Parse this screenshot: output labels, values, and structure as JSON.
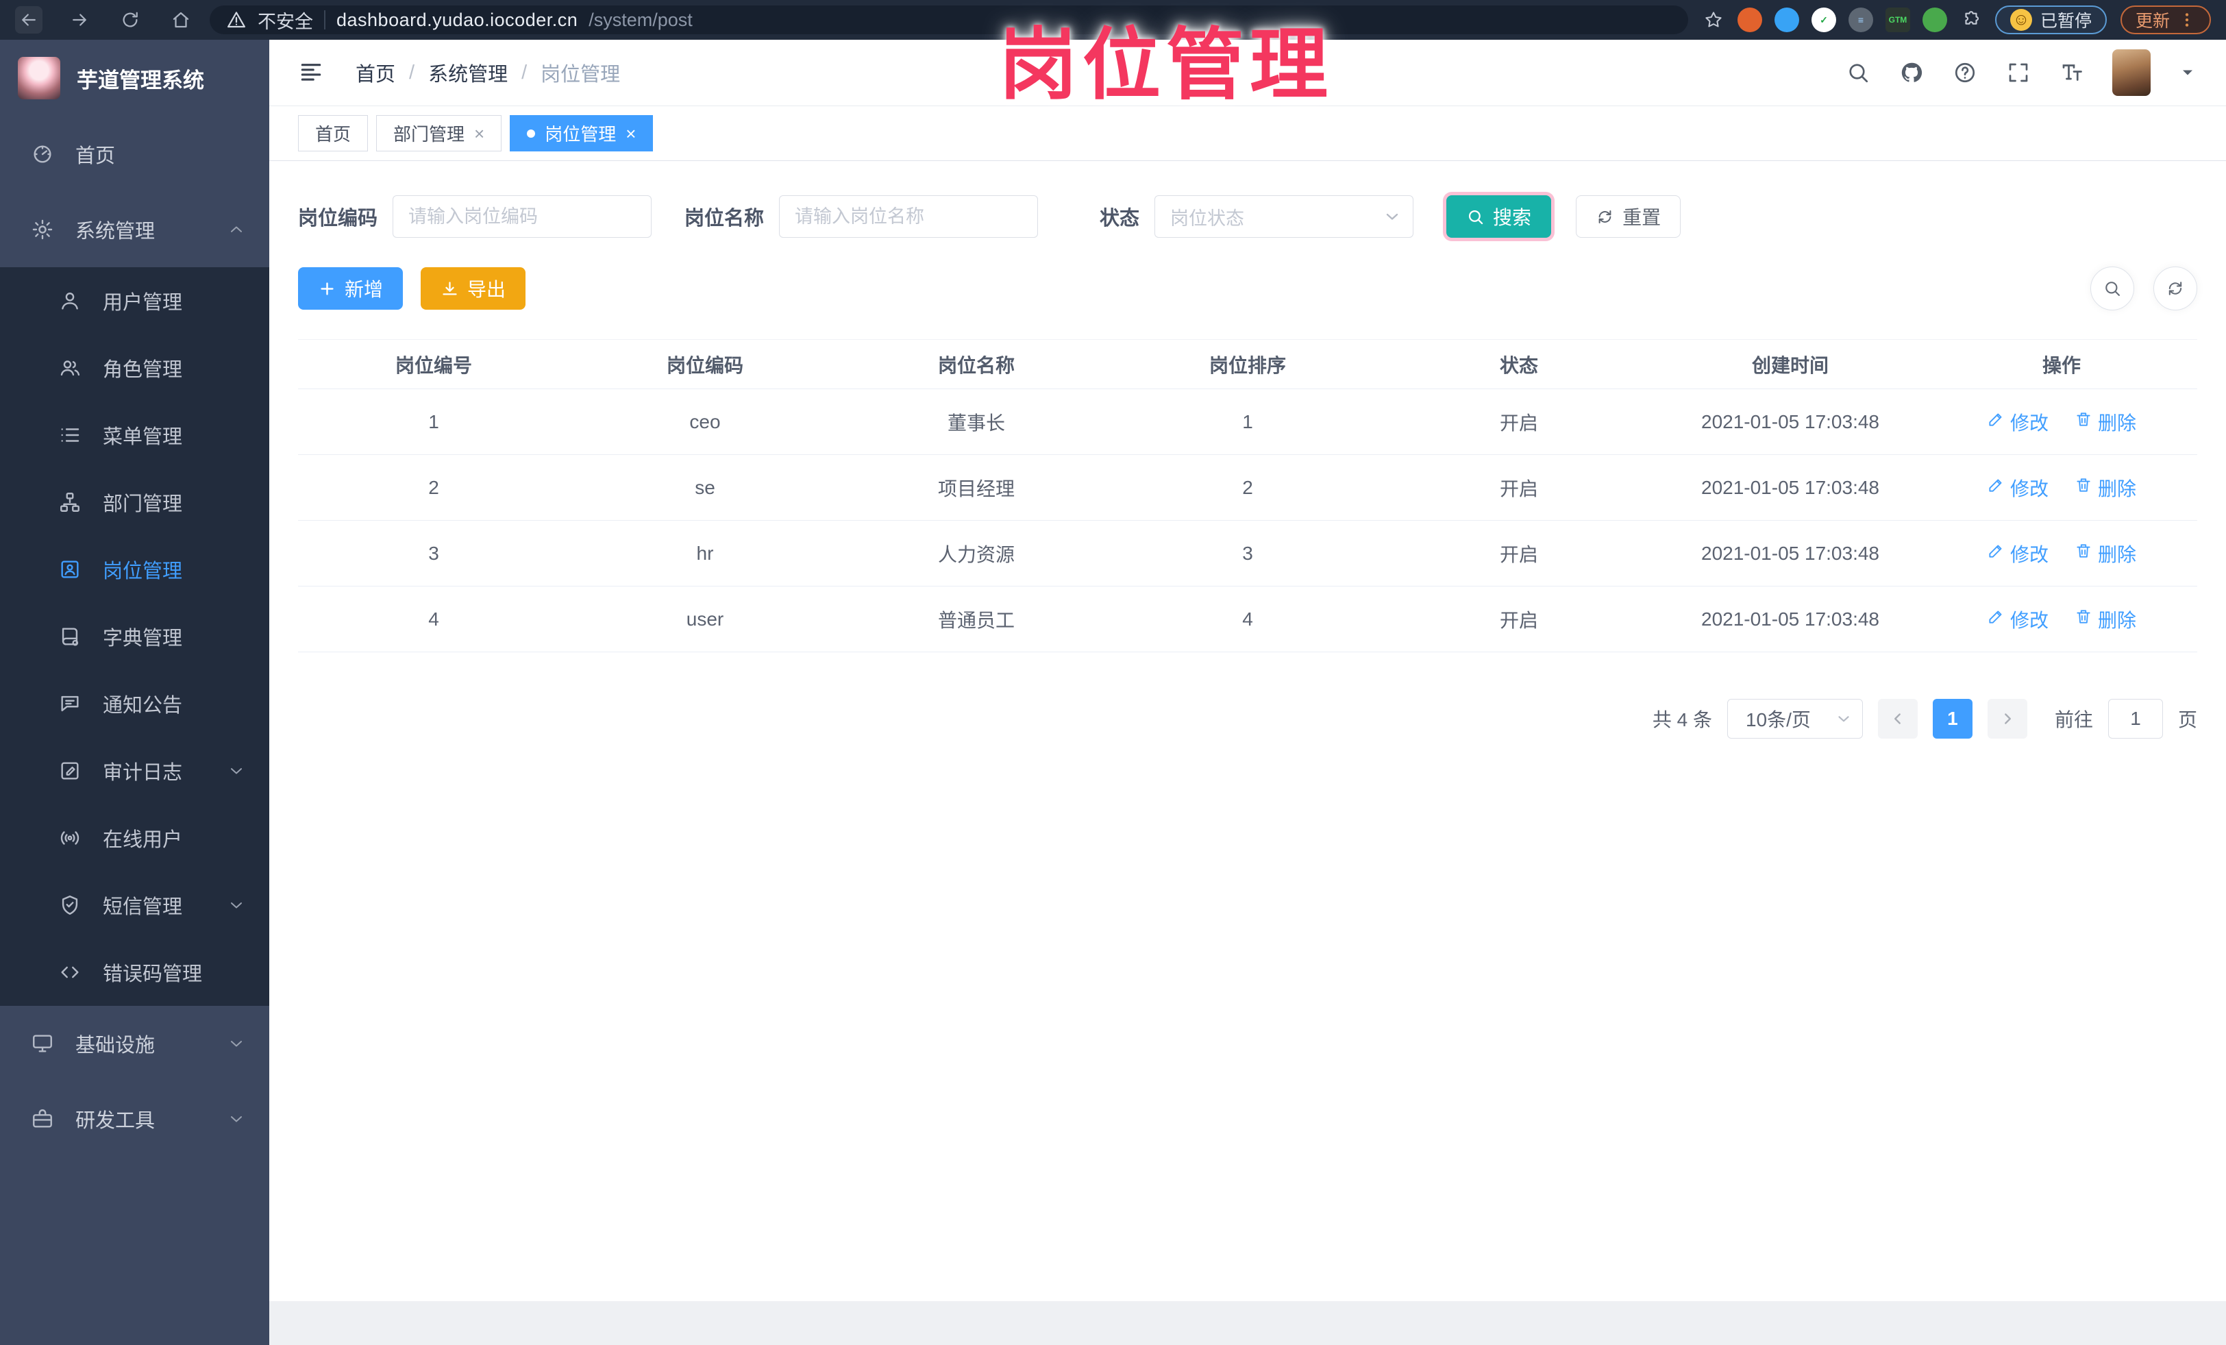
{
  "overlay": {
    "title": "岗位管理"
  },
  "browser": {
    "security_label": "不安全",
    "url_host": "dashboard.yudao.iocoder.cn",
    "url_path": "/system/post",
    "paused_label": "已暂停",
    "update_label": "更新",
    "extensions": [
      {
        "key": "orange-ring-extension",
        "color": "#e2622d",
        "glyph": "",
        "glyph_color": "#ffffff"
      },
      {
        "key": "blue-drop-extension",
        "color": "#38a3f5",
        "glyph": "",
        "glyph_color": "#ffffff"
      },
      {
        "key": "green-check-extension",
        "color": "#ffffff",
        "glyph": "✓",
        "glyph_color": "#22a845"
      },
      {
        "key": "gray-stats-extension",
        "color": "#5d6773",
        "glyph": "≡",
        "glyph_color": "#9fd1ff"
      },
      {
        "key": "tag-manager-extension",
        "color": "#2c3731",
        "glyph": "GTM",
        "glyph_color": "#4cd964"
      },
      {
        "key": "green-sprout-extension",
        "color": "#49a94c",
        "glyph": "",
        "glyph_color": "#ffffff"
      }
    ]
  },
  "sidebar": {
    "app_title": "芋道管理系统",
    "items": [
      {
        "key": "home",
        "label": "首页",
        "icon": "home",
        "type": "parent"
      },
      {
        "key": "system-management",
        "label": "系统管理",
        "icon": "gear",
        "type": "parent",
        "chevron": "up",
        "expanded": true
      },
      {
        "key": "user-management",
        "label": "用户管理",
        "icon": "user",
        "type": "sub"
      },
      {
        "key": "role-management",
        "label": "角色管理",
        "icon": "users",
        "type": "sub"
      },
      {
        "key": "menu-management",
        "label": "菜单管理",
        "icon": "list",
        "type": "sub"
      },
      {
        "key": "dept-management",
        "label": "部门管理",
        "icon": "tree",
        "type": "sub"
      },
      {
        "key": "post-management",
        "label": "岗位管理",
        "icon": "badge",
        "type": "sub",
        "active": true
      },
      {
        "key": "dict-management",
        "label": "字典管理",
        "icon": "book",
        "type": "sub"
      },
      {
        "key": "notice-announcement",
        "label": "通知公告",
        "icon": "chat",
        "type": "sub"
      },
      {
        "key": "audit-log",
        "label": "审计日志",
        "icon": "log",
        "type": "sub",
        "chevron": "down"
      },
      {
        "key": "online-users",
        "label": "在线用户",
        "icon": "online",
        "type": "sub"
      },
      {
        "key": "sms-management",
        "label": "短信管理",
        "icon": "sms",
        "type": "sub",
        "chevron": "down"
      },
      {
        "key": "error-code-management",
        "label": "错误码管理",
        "icon": "code",
        "type": "sub"
      },
      {
        "key": "infrastructure",
        "label": "基础设施",
        "icon": "infra",
        "type": "parent",
        "chevron": "down"
      },
      {
        "key": "dev-tools",
        "label": "研发工具",
        "icon": "tools",
        "type": "parent",
        "chevron": "down"
      }
    ]
  },
  "header": {
    "breadcrumb": [
      "首页",
      "系统管理",
      "岗位管理"
    ]
  },
  "tabs": [
    {
      "key": "home",
      "label": "首页",
      "closable": false,
      "active": false
    },
    {
      "key": "dept-management",
      "label": "部门管理",
      "closable": true,
      "active": false
    },
    {
      "key": "post-management",
      "label": "岗位管理",
      "closable": true,
      "active": true
    }
  ],
  "filters": {
    "post_code_label": "岗位编码",
    "post_code_placeholder": "请输入岗位编码",
    "post_name_label": "岗位名称",
    "post_name_placeholder": "请输入岗位名称",
    "status_label": "状态",
    "status_placeholder": "岗位状态",
    "search_label": "搜索",
    "reset_label": "重置"
  },
  "toolbar": {
    "add_label": "新增",
    "export_label": "导出"
  },
  "table": {
    "headers": [
      "岗位编号",
      "岗位编码",
      "岗位名称",
      "岗位排序",
      "状态",
      "创建时间",
      "操作"
    ],
    "rows": [
      {
        "id": "1",
        "code": "ceo",
        "name": "董事长",
        "sort": "1",
        "status": "开启",
        "created_at": "2021-01-05 17:03:48"
      },
      {
        "id": "2",
        "code": "se",
        "name": "项目经理",
        "sort": "2",
        "status": "开启",
        "created_at": "2021-01-05 17:03:48"
      },
      {
        "id": "3",
        "code": "hr",
        "name": "人力资源",
        "sort": "3",
        "status": "开启",
        "created_at": "2021-01-05 17:03:48"
      },
      {
        "id": "4",
        "code": "user",
        "name": "普通员工",
        "sort": "4",
        "status": "开启",
        "created_at": "2021-01-05 17:03:48"
      }
    ],
    "edit_label": "修改",
    "delete_label": "删除"
  },
  "pagination": {
    "total_label": "共 4 条",
    "page_size_label": "10条/页",
    "current_page": "1",
    "goto_label": "前往",
    "goto_value": "1",
    "unit_label": "页"
  },
  "colors": {
    "accent_blue": "#409EFF",
    "search_teal": "#18b2a8",
    "export_orange": "#f2a712",
    "watermark_pink": "#f4375f",
    "sidebar_dark": "#222c3d",
    "sidebar_light": "#3c475f",
    "browser_bar": "#212b3b"
  }
}
